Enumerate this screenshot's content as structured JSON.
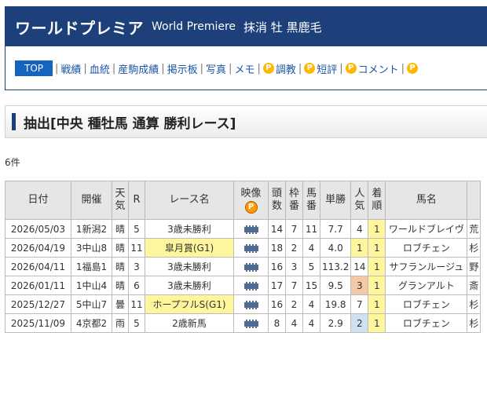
{
  "header": {
    "name": "ワールドプレミア",
    "name_en": "World Premiere",
    "status": "抹消 牡 黒鹿毛"
  },
  "nav": {
    "top": "TOP",
    "items": [
      "戦績",
      "血統",
      "産駒成績",
      "掲示板",
      "写真",
      "メモ",
      "調教",
      "短評",
      "コメント"
    ],
    "premium_icon": "P"
  },
  "section": {
    "title": "抽出[中央 種牡馬 通算 勝利レース]"
  },
  "count": "6件",
  "table": {
    "headers": {
      "date": "日付",
      "venue": "開催",
      "weather": "天気",
      "r": "R",
      "race": "レース名",
      "video": "映像",
      "video_icon": "P",
      "heads": "頭数",
      "waku": "枠番",
      "umaban": "馬番",
      "odds": "単勝",
      "pop": "人気",
      "finish": "着順",
      "horse": "馬名"
    },
    "rows": [
      {
        "date": "2026/05/03",
        "venue": "1新潟2",
        "weather": "晴",
        "r": "5",
        "race": "3歳未勝利",
        "heads": "14",
        "waku": "7",
        "umaban": "11",
        "odds": "7.7",
        "pop": "4",
        "finish": "1",
        "horse": "ワールドブレイヴ",
        "extra": "荒"
      },
      {
        "date": "2026/04/19",
        "venue": "3中山8",
        "weather": "晴",
        "r": "11",
        "race": "皐月賞(G1)",
        "heads": "18",
        "waku": "2",
        "umaban": "4",
        "odds": "4.0",
        "pop": "1",
        "finish": "1",
        "horse": "ロブチェン",
        "extra": "杉"
      },
      {
        "date": "2026/04/11",
        "venue": "1福島1",
        "weather": "晴",
        "r": "3",
        "race": "3歳未勝利",
        "heads": "16",
        "waku": "3",
        "umaban": "5",
        "odds": "113.2",
        "pop": "14",
        "finish": "1",
        "horse": "サフランルージュ",
        "extra": "野"
      },
      {
        "date": "2026/01/11",
        "venue": "1中山4",
        "weather": "晴",
        "r": "6",
        "race": "3歳未勝利",
        "heads": "17",
        "waku": "7",
        "umaban": "15",
        "odds": "9.5",
        "pop": "3",
        "finish": "1",
        "horse": "グランアルト",
        "extra": "斎"
      },
      {
        "date": "2025/12/27",
        "venue": "5中山7",
        "weather": "曇",
        "r": "11",
        "race": "ホープフルS(G1)",
        "heads": "16",
        "waku": "2",
        "umaban": "4",
        "odds": "19.8",
        "pop": "7",
        "finish": "1",
        "horse": "ロブチェン",
        "extra": "杉"
      },
      {
        "date": "2025/11/09",
        "venue": "4京都2",
        "weather": "雨",
        "r": "5",
        "race": "2歳新馬",
        "heads": "8",
        "waku": "4",
        "umaban": "4",
        "odds": "2.9",
        "pop": "2",
        "finish": "1",
        "horse": "ロブチェン",
        "extra": "杉"
      }
    ]
  }
}
